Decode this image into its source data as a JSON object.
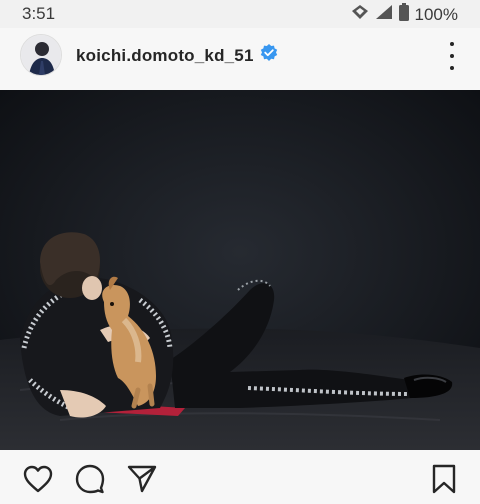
{
  "status_bar": {
    "time": "3:51",
    "battery": "100%",
    "icons": [
      "data-saver-icon",
      "signal-icon",
      "battery-icon"
    ]
  },
  "post": {
    "username": "koichi.domoto_kd_51",
    "verified": true,
    "verified_badge_color": "#3897f0",
    "more_icon": "more-vertical-icon",
    "image_description_icon": "photo"
  },
  "actions": {
    "like_icon": "heart-icon",
    "comment_icon": "comment-icon",
    "share_icon": "send-icon",
    "save_icon": "bookmark-icon"
  }
}
